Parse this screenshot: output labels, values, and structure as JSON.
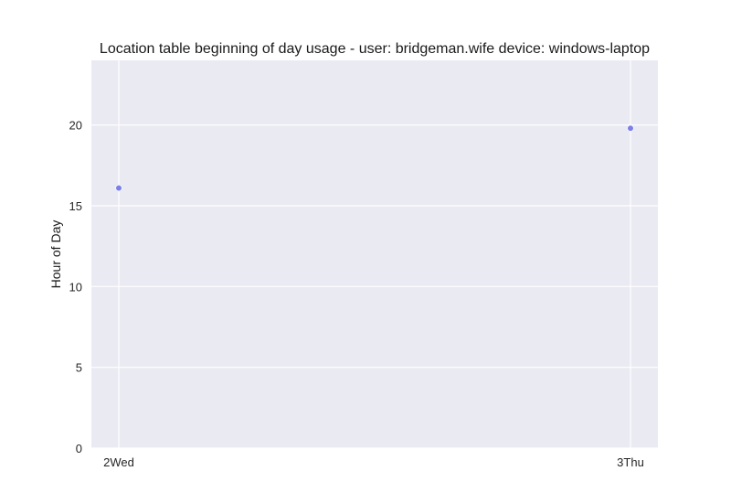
{
  "chart_data": {
    "type": "scatter",
    "title": "Location table beginning of day usage -  user: bridgeman.wife device: windows-laptop",
    "xlabel": "",
    "ylabel": "Hour of Day",
    "categories": [
      "2Wed",
      "3Thu"
    ],
    "series": [
      {
        "values": [
          16.1,
          19.8
        ],
        "color": "#7b7fe6"
      }
    ],
    "ylim": [
      0,
      24
    ],
    "yticks": [
      0,
      5,
      10,
      15,
      20
    ],
    "grid": true,
    "background": "#eaeaf2",
    "legend": "none"
  }
}
